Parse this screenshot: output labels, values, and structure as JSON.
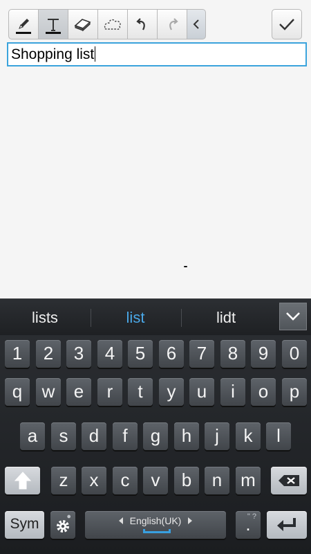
{
  "toolbar": {
    "tools": [
      {
        "icon": "pen-icon",
        "active": false
      },
      {
        "icon": "text-icon",
        "active": true
      },
      {
        "icon": "eraser-icon",
        "active": false
      },
      {
        "icon": "lasso-icon",
        "active": false
      },
      {
        "icon": "undo-icon",
        "active": false
      },
      {
        "icon": "redo-icon",
        "active": false
      }
    ],
    "collapse_icon": "chevron-left-icon",
    "done_icon": "checkmark-icon"
  },
  "note": {
    "text_value": "Shopping list"
  },
  "suggestions": {
    "items": [
      "lists",
      "list",
      "lidt"
    ],
    "selected": "list",
    "selected_color": "#4aa9e9",
    "expand_icon": "chevron-down-icon"
  },
  "keyboard": {
    "number_row": [
      "1",
      "2",
      "3",
      "4",
      "5",
      "6",
      "7",
      "8",
      "9",
      "0"
    ],
    "row1": [
      "q",
      "w",
      "e",
      "r",
      "t",
      "y",
      "u",
      "i",
      "o",
      "p"
    ],
    "row2": [
      "a",
      "s",
      "d",
      "f",
      "g",
      "h",
      "j",
      "k",
      "l"
    ],
    "row3": [
      "z",
      "x",
      "c",
      "v",
      "b",
      "n",
      "m"
    ],
    "sym_label": "Sym",
    "language_label": "English(UK)",
    "period_label": ".",
    "period_hint": "\" ?",
    "shift_icon": "shift-arrow-icon",
    "backspace_icon": "backspace-icon",
    "enter_icon": "enter-icon",
    "settings_icon": "gear-icon",
    "accent_color": "#39a0e0"
  }
}
